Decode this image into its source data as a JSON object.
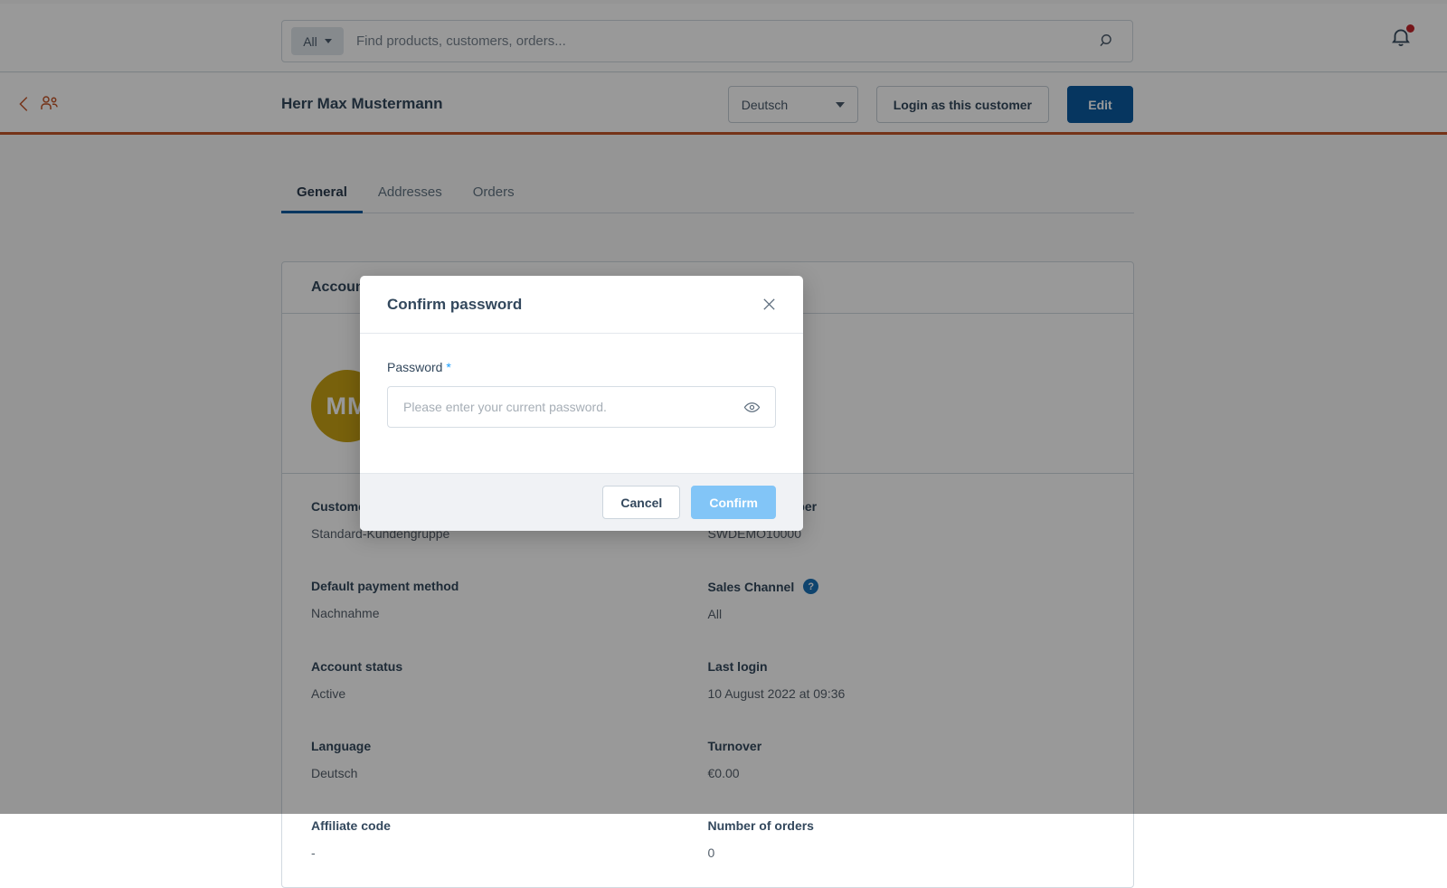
{
  "topbar": {
    "scope_label": "All",
    "search_placeholder": "Find products, customers, orders...",
    "search_value": "",
    "search_icon": "search-icon",
    "bell_icon": "bell-icon",
    "bell_has_notification": true
  },
  "smartbar": {
    "back_icon": "chevron-left-icon",
    "entity_icon": "customers-icon",
    "title": "Herr Max Mustermann",
    "language_value": "Deutsch",
    "login_as_label": "Login as this customer",
    "edit_label": "Edit",
    "accent_color": "#c45629",
    "primary_color": "#0b5ba0"
  },
  "tabs": [
    {
      "label": "General",
      "active": true
    },
    {
      "label": "Addresses",
      "active": false
    },
    {
      "label": "Orders",
      "active": false
    }
  ],
  "card": {
    "title": "Account",
    "avatar_initials": "MM",
    "avatar_color": "#c8a214",
    "fields": [
      {
        "label": "Customer group",
        "value": "Standard-Kundengruppe",
        "help": false
      },
      {
        "label": "Customer number",
        "value": "SWDEMO10000",
        "help": false
      },
      {
        "label": "Default payment method",
        "value": "Nachnahme",
        "help": false
      },
      {
        "label": "Sales Channel",
        "value": "All",
        "help": true
      },
      {
        "label": "Account status",
        "value": "Active",
        "help": false
      },
      {
        "label": "Last login",
        "value": "10 August 2022 at 09:36",
        "help": false
      },
      {
        "label": "Language",
        "value": "Deutsch",
        "help": false
      },
      {
        "label": "Turnover",
        "value": "€0.00",
        "help": false
      },
      {
        "label": "Affiliate code",
        "value": "-",
        "help": false
      },
      {
        "label": "Number of orders",
        "value": "0",
        "help": false
      }
    ]
  },
  "modal": {
    "title": "Confirm password",
    "close_icon": "close-icon",
    "password_label": "Password",
    "required_marker": "*",
    "password_placeholder": "Please enter your current password.",
    "password_value": "",
    "eye_icon": "eye-icon",
    "cancel_label": "Cancel",
    "confirm_label": "Confirm",
    "confirm_disabled": true
  }
}
